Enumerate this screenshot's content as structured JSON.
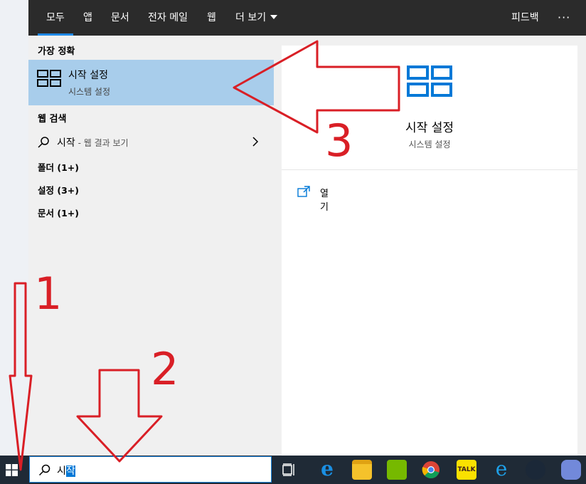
{
  "tabs": [
    {
      "label": "모두",
      "active": true
    },
    {
      "label": "앱"
    },
    {
      "label": "문서"
    },
    {
      "label": "전자 메일"
    },
    {
      "label": "웹"
    },
    {
      "label": "더 보기"
    }
  ],
  "header": {
    "feedback": "피드백",
    "more": "···"
  },
  "best_match": {
    "heading": "가장 정확",
    "title": "시작 설정",
    "subtitle": "시스템 설정"
  },
  "web": {
    "heading": "웹 검색",
    "query": "시작",
    "suffix": " - 웹 결과 보기"
  },
  "categories": [
    "폴더 (1+)",
    "설정 (3+)",
    "문서 (1+)"
  ],
  "preview": {
    "title": "시작 설정",
    "subtitle": "시스템 설정",
    "action_open": "열기"
  },
  "search": {
    "text_before": "시",
    "text_selected": "작"
  },
  "annotations": {
    "a1": "1",
    "a2": "2",
    "a3": "3"
  },
  "taskbar_icons": [
    "windows-start-icon",
    "task-view-icon",
    "edge-icon",
    "file-explorer-icon",
    "nvidia-icon",
    "chrome-icon",
    "kakaotalk-icon",
    "internet-explorer-icon",
    "steam-icon",
    "discord-icon"
  ],
  "colors": {
    "accent": "#1e88e5",
    "annotation": "#d91f26",
    "selected": "#a8cdeb"
  }
}
